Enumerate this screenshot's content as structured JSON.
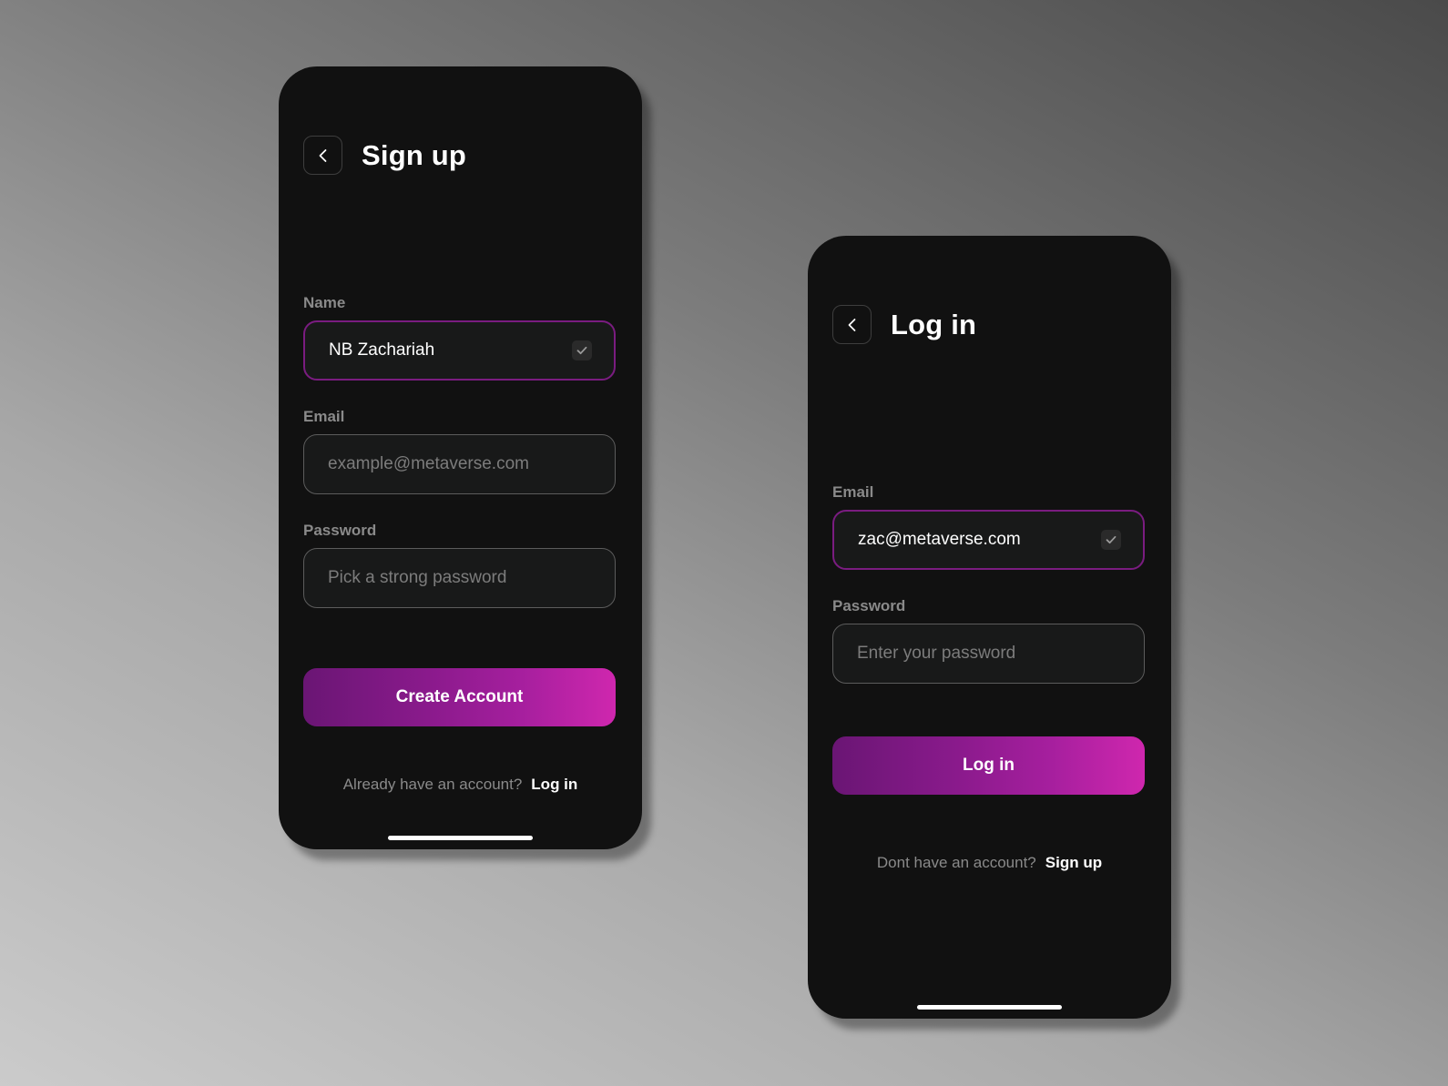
{
  "signup_screen": {
    "title": "Sign up",
    "back_icon": "chevron-left-icon",
    "fields": {
      "name": {
        "label": "Name",
        "value": "NB Zachariah",
        "placeholder": "",
        "validated": true,
        "focused": true
      },
      "email": {
        "label": "Email",
        "value": "",
        "placeholder": "example@metaverse.com"
      },
      "password": {
        "label": "Password",
        "value": "",
        "placeholder": "Pick a strong password"
      }
    },
    "primary_button": "Create Account",
    "alt_prompt": "Already have an account?",
    "alt_link": "Log in"
  },
  "login_screen": {
    "title": "Log in",
    "back_icon": "chevron-left-icon",
    "fields": {
      "email": {
        "label": "Email",
        "value": "zac@metaverse.com",
        "placeholder": "",
        "validated": true,
        "focused": true
      },
      "password": {
        "label": "Password",
        "value": "",
        "placeholder": "Enter your password"
      }
    },
    "primary_button": "Log in",
    "alt_prompt": "Dont have an account?",
    "alt_link": "Sign up"
  },
  "colors": {
    "accent_start": "#6a1674",
    "accent_end": "#cf27ae",
    "focus_border": "#7a1c80",
    "screen_bg": "#111111",
    "label": "#8a8a8a"
  }
}
